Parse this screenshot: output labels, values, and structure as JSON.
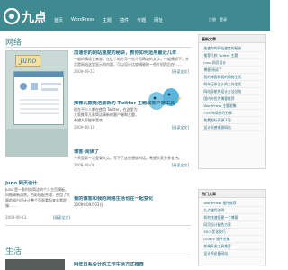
{
  "header": {
    "logo_text": "九点",
    "nav": [
      "首页",
      "WordPress",
      "主题",
      "插件",
      "专题",
      "网址"
    ],
    "login": [
      "注册",
      "登录"
    ]
  },
  "sections": {
    "network_title": "网络",
    "life_title": "生活"
  },
  "thumbnail": {
    "logo_text": "Juno"
  },
  "posts": [
    {
      "title": "加速你的网站速度的秘诀，教你如何运用最近几年",
      "body": "一般的情况上来说，在这个地方写一些介绍网站的文字，一般情况下，并且是网站这里显示的内容，可以设计比较精致的一些介绍然后在……",
      "date": "2009-09-13",
      "more": "[阅读全文]"
    },
    {
      "title": "推荐几款简洁清新的 Twitter 主题和客户端工具",
      "body": "现在不少人都在使用 Twitter，在这里为大家推荐几款简洁清新的客户端和主题，希望大家能够喜欢……",
      "date": "2009-09-10",
      "more": "[阅读全文]"
    },
    {
      "title": "博客·阅读了",
      "body": "今天是第一次登录九点，写下了这些想说的话，希望大家多多支持。",
      "date": "2009-09-08",
      "more": "[阅读全文]"
    },
    {
      "title": "我的博客和我的网络生活也在一起变化",
      "body": "2009年09月03日",
      "date": "",
      "more": ""
    }
  ],
  "caption": {
    "title": "Juno 网页设计",
    "body": "Juno 是一款时尚简洁的个人主页模板，风格清新自然，色彩搭配合理，使用了大量的留白设计让整个页面看起来非常舒服……",
    "date": "2009-09-13",
    "more": "[阅读全文]"
  },
  "life_post": {
    "title": "明年日系设计的工作生活方式推荐"
  },
  "sidebar": {
    "widget1_title": "最新文章",
    "widget1_items": [
      "加速你的网站速度的秘诀",
      "推荐几款 Twitter 主题",
      "Juno 网页设计",
      "博客·阅读了",
      "我的博客和我的网络生活",
      "明年日系设计的工作生活",
      "网站导航的设计方法总结",
      "国内外优秀博客推荐",
      "WordPress 主题收集",
      "CSS 布局技巧分享",
      "免费图标资源下载",
      "设计灵感来源网站"
    ],
    "widget2_title": "热门文章",
    "widget2_items": [
      "WordPress 插件推荐",
      "九点使用说明",
      "如何快速搭建一个博客",
      "网页设计配色方案",
      "SEO 优化技巧",
      "jQuery 插件合集",
      "前端开发工具推荐",
      "设计师必备网站"
    ]
  },
  "colors": {
    "header_bg": "#3f8a90",
    "accent": "#3f8a90",
    "link": "#2a6e84"
  }
}
